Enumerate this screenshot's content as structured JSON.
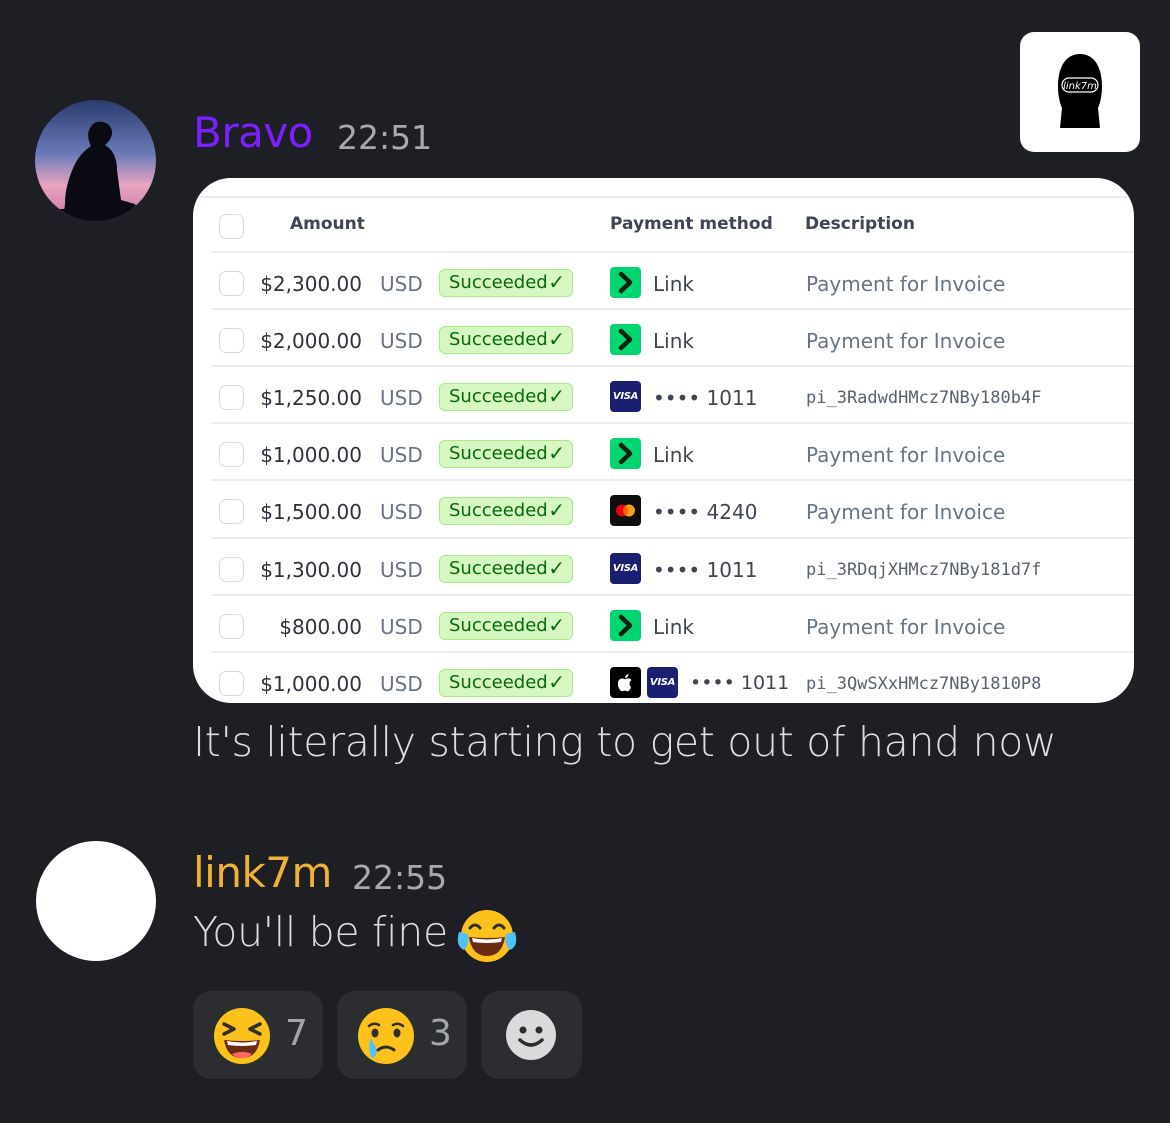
{
  "messages": [
    {
      "username": "Bravo",
      "username_color": "#7a1fff",
      "timestamp": "22:51",
      "text": "It's literally starting to get out of hand now",
      "attachment": {
        "headers": {
          "amount": "Amount",
          "payment_method": "Payment method",
          "description": "Description"
        },
        "rows": [
          {
            "amount": "$2,300.00",
            "currency": "USD",
            "status": "Succeeded",
            "method_icon": "link-icon",
            "method_text": "Link",
            "description": "Payment for Invoice"
          },
          {
            "amount": "$2,000.00",
            "currency": "USD",
            "status": "Succeeded",
            "method_icon": "link-icon",
            "method_text": "Link",
            "description": "Payment for Invoice"
          },
          {
            "amount": "$1,250.00",
            "currency": "USD",
            "status": "Succeeded",
            "method_icon": "visa-icon",
            "method_text": "•••• 1011",
            "description": "pi_3RadwdHMcz7NBy180b4F"
          },
          {
            "amount": "$1,000.00",
            "currency": "USD",
            "status": "Succeeded",
            "method_icon": "link-icon",
            "method_text": "Link",
            "description": "Payment for Invoice"
          },
          {
            "amount": "$1,500.00",
            "currency": "USD",
            "status": "Succeeded",
            "method_icon": "mastercard-icon",
            "method_text": "•••• 4240",
            "description": "Payment for Invoice"
          },
          {
            "amount": "$1,300.00",
            "currency": "USD",
            "status": "Succeeded",
            "method_icon": "visa-icon",
            "method_text": "•••• 1011",
            "description": "pi_3RDqjXHMcz7NBy181d7f"
          },
          {
            "amount": "$800.00",
            "currency": "USD",
            "status": "Succeeded",
            "method_icon": "link-icon",
            "method_text": "Link",
            "description": "Payment for Invoice"
          },
          {
            "amount": "$1,000.00",
            "currency": "USD",
            "status": "Succeeded",
            "method_icon": "apple-pay-visa-icon",
            "method_text": "•••• 1011",
            "description": "pi_3QwSXxHMcz7NBy1810P8"
          }
        ],
        "visa_label": "VISA"
      }
    },
    {
      "username": "link7m",
      "username_color": "#f0b232",
      "timestamp": "22:55",
      "text": "You'll be fine",
      "text_emoji": "joy-emoji"
    }
  ],
  "corner_logo_text": "link7m",
  "reactions": [
    {
      "emoji": "laughing-emoji",
      "count": "7"
    },
    {
      "emoji": "crying-emoji",
      "count": "3"
    },
    {
      "emoji": "add-reaction-icon",
      "count": ""
    }
  ]
}
